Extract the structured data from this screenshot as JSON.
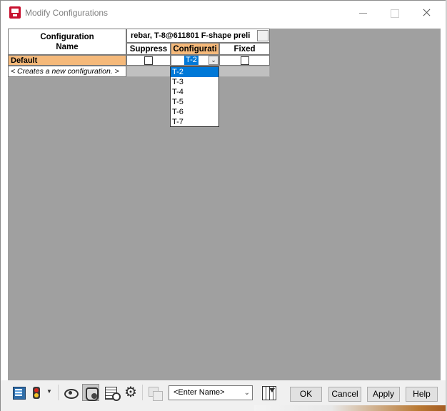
{
  "window": {
    "title": "Modify Configurations",
    "icon": "solidworks-app-icon",
    "controls": [
      "minimize",
      "maximize",
      "close"
    ]
  },
  "grid": {
    "header_config_name_line1": "Configuration",
    "header_config_name_line2": "Name",
    "header_feature": "rebar, T-8@611801 F-shape preli",
    "columns": [
      "Suppress",
      "Configurati",
      "Fixed"
    ],
    "rows": [
      {
        "name": "Default",
        "suppress": false,
        "configuration": "T-2",
        "fixed": false
      }
    ],
    "new_row_text": "< Creates a new configuration. >"
  },
  "dropdown": {
    "selected": "T-2",
    "options": [
      "T-2",
      "T-3",
      "T-4",
      "T-5",
      "T-6",
      "T-7"
    ]
  },
  "toolbar": {
    "icons": [
      "excel-export-icon",
      "traffic-light-icon",
      "show-hide-icon",
      "hand-icon",
      "list-icon",
      "gear-icon",
      "table-icon",
      "insert-column-icon"
    ],
    "name_select_value": "<Enter Name>",
    "ok_label": "OK",
    "cancel_label": "Cancel",
    "apply_label": "Apply",
    "help_label": "Help"
  },
  "colors": {
    "grid_background": "#a0a0a0",
    "header_highlight": "#f5b97a",
    "selection": "#0078d7"
  }
}
